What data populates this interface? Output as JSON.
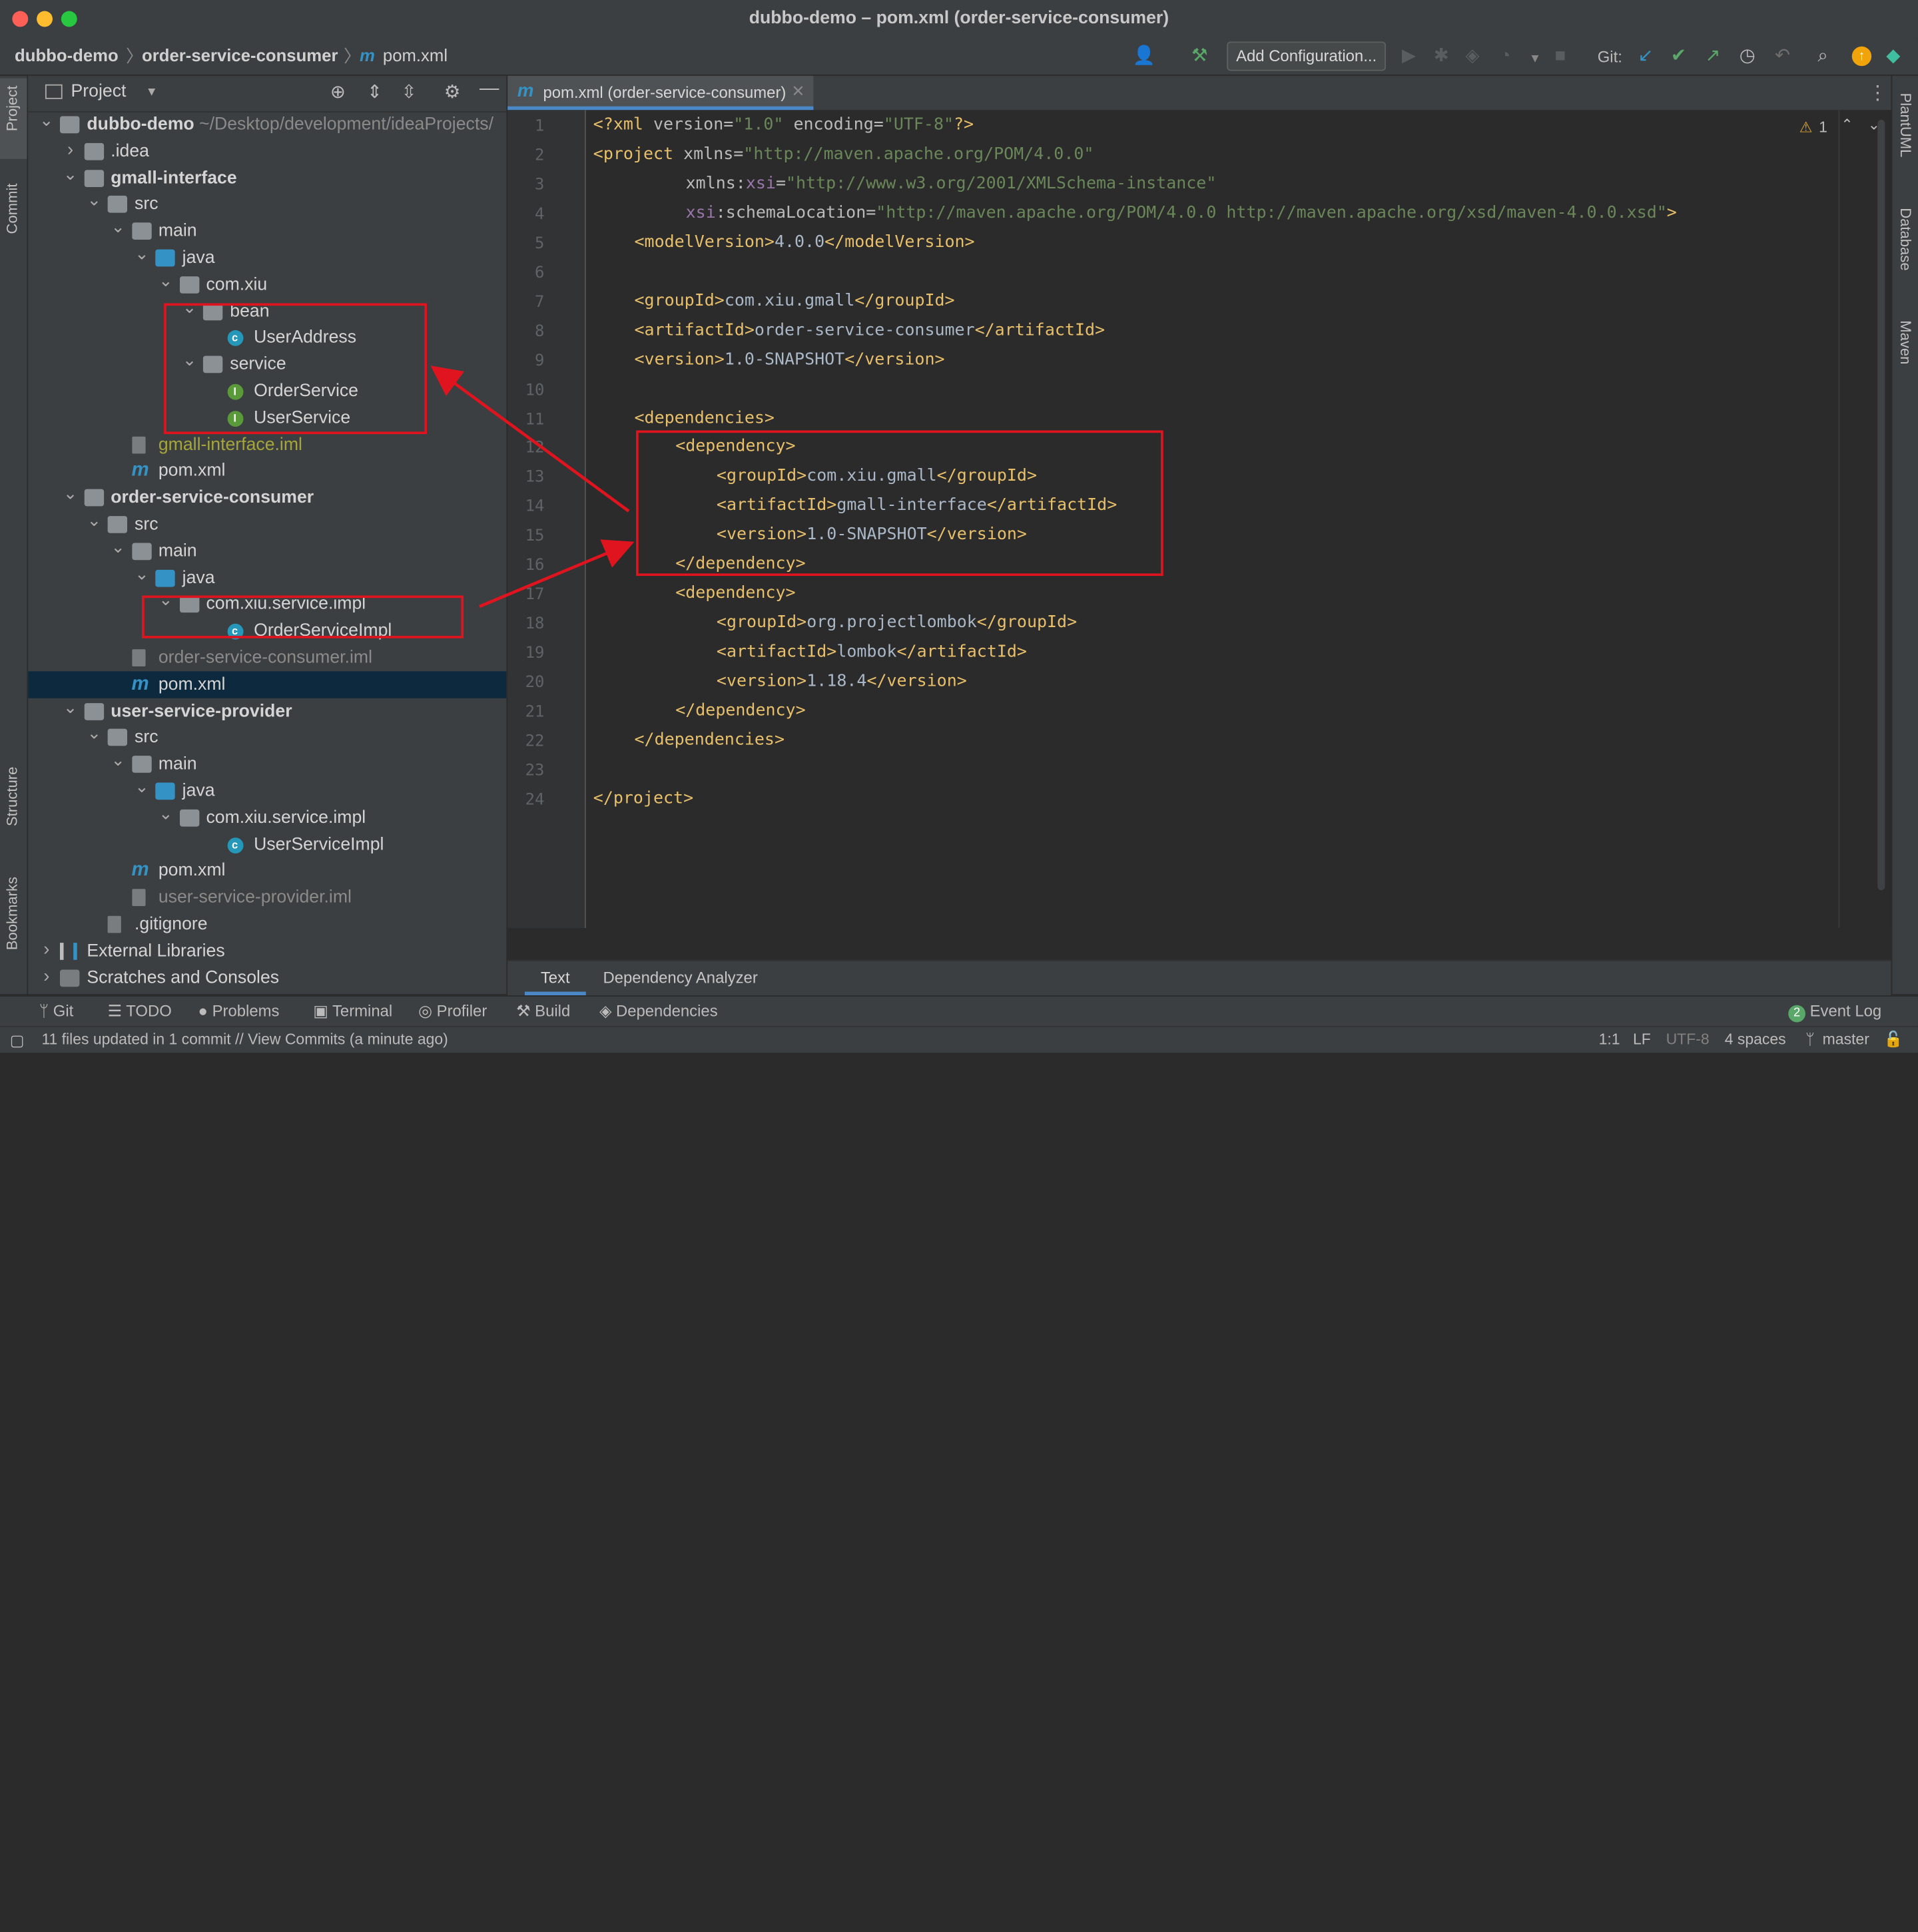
{
  "window": {
    "title": "dubbo-demo – pom.xml (order-service-consumer)"
  },
  "breadcrumb": {
    "project": "dubbo-demo",
    "module": "order-service-consumer",
    "file_icon": "m",
    "file": "pom.xml"
  },
  "toolbar": {
    "add_configuration": "Add Configuration...",
    "git_label": "Git:"
  },
  "left_tabs": {
    "project": "Project",
    "commit": "Commit",
    "structure": "Structure",
    "bookmarks": "Bookmarks"
  },
  "right_tabs": {
    "plantuml": "PlantUML",
    "database": "Database",
    "maven": "Maven"
  },
  "project_panel": {
    "title": "Project",
    "tree": [
      {
        "label": "dubbo-demo",
        "suffix": "~/Desktop/development/ideaProjects/",
        "bold": true
      },
      {
        "label": ".idea"
      },
      {
        "label": "gmall-interface",
        "bold": true
      },
      {
        "label": "src"
      },
      {
        "label": "main"
      },
      {
        "label": "java"
      },
      {
        "label": "com.xiu"
      },
      {
        "label": "bean"
      },
      {
        "label": "UserAddress",
        "type_badge": "c"
      },
      {
        "label": "service"
      },
      {
        "label": "OrderService",
        "type_badge": "I"
      },
      {
        "label": "UserService",
        "type_badge": "I"
      },
      {
        "label": "gmall-interface.iml"
      },
      {
        "label": "pom.xml",
        "type_badge": "m"
      },
      {
        "label": "order-service-consumer",
        "bold": true
      },
      {
        "label": "src"
      },
      {
        "label": "main"
      },
      {
        "label": "java"
      },
      {
        "label": "com.xiu.service.impl"
      },
      {
        "label": "OrderServiceImpl",
        "type_badge": "c"
      },
      {
        "label": "order-service-consumer.iml"
      },
      {
        "label": "pom.xml",
        "type_badge": "m",
        "selected": true
      },
      {
        "label": "user-service-provider",
        "bold": true
      },
      {
        "label": "src"
      },
      {
        "label": "main"
      },
      {
        "label": "java"
      },
      {
        "label": "com.xiu.service.impl"
      },
      {
        "label": "UserServiceImpl",
        "type_badge": "c"
      },
      {
        "label": "pom.xml",
        "type_badge": "m"
      },
      {
        "label": "user-service-provider.iml"
      },
      {
        "label": ".gitignore"
      },
      {
        "label": "External Libraries"
      },
      {
        "label": "Scratches and Consoles"
      }
    ]
  },
  "editor": {
    "tab_label": "pom.xml (order-service-consumer)",
    "tab_icon": "m",
    "inspection_count": "1",
    "lines": [
      "1",
      "2",
      "3",
      "4",
      "5",
      "6",
      "7",
      "8",
      "9",
      "10",
      "11",
      "12",
      "13",
      "14",
      "15",
      "16",
      "17",
      "18",
      "19",
      "20",
      "21",
      "22",
      "23",
      "24"
    ],
    "code": {
      "l1_a": "<?xml ",
      "l1_b": "version",
      "l1_c": "=",
      "l1_d": "\"1.0\"",
      "l1_e": " encoding",
      "l1_f": "=",
      "l1_g": "\"UTF-8\"",
      "l1_h": "?>",
      "l2_tag": "<project ",
      "l2_attr": "xmlns",
      "l2_eq": "=",
      "l2_val": "\"http://maven.apache.org/POM/4.0.0\"",
      "l3_attr": "xmlns:",
      "l3_ns": "xsi",
      "l3_eq": "=",
      "l3_val": "\"http://www.w3.org/2001/XMLSchema-instance\"",
      "l4_ns": "xsi",
      "l4_attr": ":schemaLocation",
      "l4_eq": "=",
      "l4_val": "\"http://maven.apache.org/POM/4.0.0 http://maven.apache.org/xsd/maven-4.0.0.xsd\"",
      "l4_end": ">",
      "l5_open": "<modelVersion>",
      "l5_text": "4.0.0",
      "l5_close": "</modelVersion>",
      "l7_open": "<groupId>",
      "l7_text": "com.xiu.gmall",
      "l7_close": "</groupId>",
      "l8_open": "<artifactId>",
      "l8_text": "order-service-consumer",
      "l8_close": "</artifactId>",
      "l9_open": "<version>",
      "l9_text": "1.0-SNAPSHOT",
      "l9_close": "</version>",
      "l11": "<dependencies>",
      "l12": "<dependency>",
      "l13_open": "<groupId>",
      "l13_text": "com.xiu.gmall",
      "l13_close": "</groupId>",
      "l14_open": "<artifactId>",
      "l14_text": "gmall-interface",
      "l14_close": "</artifactId>",
      "l15_open": "<version>",
      "l15_text": "1.0-SNAPSHOT",
      "l15_close": "</version>",
      "l16": "</dependency>",
      "l17": "<dependency>",
      "l18_open": "<groupId>",
      "l18_text": "org.projectlombok",
      "l18_close": "</groupId>",
      "l19_open": "<artifactId>",
      "l19_text": "lombok",
      "l19_close": "</artifactId>",
      "l20_open": "<version>",
      "l20_text": "1.18.4",
      "l20_close": "</version>",
      "l21": "</dependency>",
      "l22": "</dependencies>",
      "l24": "</project>"
    },
    "bottom_tabs": [
      "Text",
      "Dependency Analyzer"
    ]
  },
  "tool_windows": [
    "Git",
    "TODO",
    "Problems",
    "Terminal",
    "Profiler",
    "Build",
    "Dependencies"
  ],
  "event_log": {
    "count": "2",
    "label": "Event Log"
  },
  "status_bar": {
    "message": "11 files updated in 1 commit // View Commits (a minute ago)",
    "position": "1:1",
    "line_sep": "LF",
    "encoding": "UTF-8",
    "indent": "4 spaces",
    "branch": "master"
  },
  "colors": {
    "tag": "#e8bf6a",
    "string": "#6a8759",
    "namespace": "#9876aa",
    "annotation_red": "#e0141e"
  }
}
